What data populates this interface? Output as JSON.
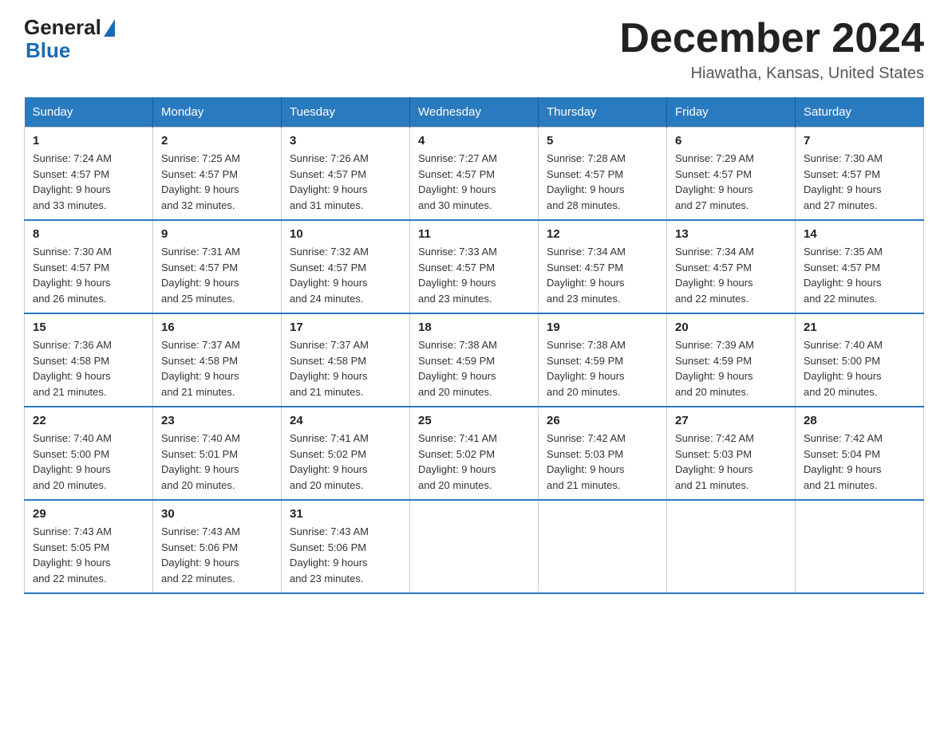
{
  "logo": {
    "general": "General",
    "blue": "Blue"
  },
  "title": "December 2024",
  "subtitle": "Hiawatha, Kansas, United States",
  "days_of_week": [
    "Sunday",
    "Monday",
    "Tuesday",
    "Wednesday",
    "Thursday",
    "Friday",
    "Saturday"
  ],
  "weeks": [
    [
      {
        "day": "1",
        "sunrise": "7:24 AM",
        "sunset": "4:57 PM",
        "daylight": "9 hours and 33 minutes."
      },
      {
        "day": "2",
        "sunrise": "7:25 AM",
        "sunset": "4:57 PM",
        "daylight": "9 hours and 32 minutes."
      },
      {
        "day": "3",
        "sunrise": "7:26 AM",
        "sunset": "4:57 PM",
        "daylight": "9 hours and 31 minutes."
      },
      {
        "day": "4",
        "sunrise": "7:27 AM",
        "sunset": "4:57 PM",
        "daylight": "9 hours and 30 minutes."
      },
      {
        "day": "5",
        "sunrise": "7:28 AM",
        "sunset": "4:57 PM",
        "daylight": "9 hours and 28 minutes."
      },
      {
        "day": "6",
        "sunrise": "7:29 AM",
        "sunset": "4:57 PM",
        "daylight": "9 hours and 27 minutes."
      },
      {
        "day": "7",
        "sunrise": "7:30 AM",
        "sunset": "4:57 PM",
        "daylight": "9 hours and 27 minutes."
      }
    ],
    [
      {
        "day": "8",
        "sunrise": "7:30 AM",
        "sunset": "4:57 PM",
        "daylight": "9 hours and 26 minutes."
      },
      {
        "day": "9",
        "sunrise": "7:31 AM",
        "sunset": "4:57 PM",
        "daylight": "9 hours and 25 minutes."
      },
      {
        "day": "10",
        "sunrise": "7:32 AM",
        "sunset": "4:57 PM",
        "daylight": "9 hours and 24 minutes."
      },
      {
        "day": "11",
        "sunrise": "7:33 AM",
        "sunset": "4:57 PM",
        "daylight": "9 hours and 23 minutes."
      },
      {
        "day": "12",
        "sunrise": "7:34 AM",
        "sunset": "4:57 PM",
        "daylight": "9 hours and 23 minutes."
      },
      {
        "day": "13",
        "sunrise": "7:34 AM",
        "sunset": "4:57 PM",
        "daylight": "9 hours and 22 minutes."
      },
      {
        "day": "14",
        "sunrise": "7:35 AM",
        "sunset": "4:57 PM",
        "daylight": "9 hours and 22 minutes."
      }
    ],
    [
      {
        "day": "15",
        "sunrise": "7:36 AM",
        "sunset": "4:58 PM",
        "daylight": "9 hours and 21 minutes."
      },
      {
        "day": "16",
        "sunrise": "7:37 AM",
        "sunset": "4:58 PM",
        "daylight": "9 hours and 21 minutes."
      },
      {
        "day": "17",
        "sunrise": "7:37 AM",
        "sunset": "4:58 PM",
        "daylight": "9 hours and 21 minutes."
      },
      {
        "day": "18",
        "sunrise": "7:38 AM",
        "sunset": "4:59 PM",
        "daylight": "9 hours and 20 minutes."
      },
      {
        "day": "19",
        "sunrise": "7:38 AM",
        "sunset": "4:59 PM",
        "daylight": "9 hours and 20 minutes."
      },
      {
        "day": "20",
        "sunrise": "7:39 AM",
        "sunset": "4:59 PM",
        "daylight": "9 hours and 20 minutes."
      },
      {
        "day": "21",
        "sunrise": "7:40 AM",
        "sunset": "5:00 PM",
        "daylight": "9 hours and 20 minutes."
      }
    ],
    [
      {
        "day": "22",
        "sunrise": "7:40 AM",
        "sunset": "5:00 PM",
        "daylight": "9 hours and 20 minutes."
      },
      {
        "day": "23",
        "sunrise": "7:40 AM",
        "sunset": "5:01 PM",
        "daylight": "9 hours and 20 minutes."
      },
      {
        "day": "24",
        "sunrise": "7:41 AM",
        "sunset": "5:02 PM",
        "daylight": "9 hours and 20 minutes."
      },
      {
        "day": "25",
        "sunrise": "7:41 AM",
        "sunset": "5:02 PM",
        "daylight": "9 hours and 20 minutes."
      },
      {
        "day": "26",
        "sunrise": "7:42 AM",
        "sunset": "5:03 PM",
        "daylight": "9 hours and 21 minutes."
      },
      {
        "day": "27",
        "sunrise": "7:42 AM",
        "sunset": "5:03 PM",
        "daylight": "9 hours and 21 minutes."
      },
      {
        "day": "28",
        "sunrise": "7:42 AM",
        "sunset": "5:04 PM",
        "daylight": "9 hours and 21 minutes."
      }
    ],
    [
      {
        "day": "29",
        "sunrise": "7:43 AM",
        "sunset": "5:05 PM",
        "daylight": "9 hours and 22 minutes."
      },
      {
        "day": "30",
        "sunrise": "7:43 AM",
        "sunset": "5:06 PM",
        "daylight": "9 hours and 22 minutes."
      },
      {
        "day": "31",
        "sunrise": "7:43 AM",
        "sunset": "5:06 PM",
        "daylight": "9 hours and 23 minutes."
      },
      null,
      null,
      null,
      null
    ]
  ],
  "labels": {
    "sunrise": "Sunrise:",
    "sunset": "Sunset:",
    "daylight": "Daylight:"
  },
  "colors": {
    "header_bg": "#2a7abf",
    "header_text": "#ffffff",
    "border": "#cccccc",
    "logo_blue": "#1a6bb5"
  }
}
